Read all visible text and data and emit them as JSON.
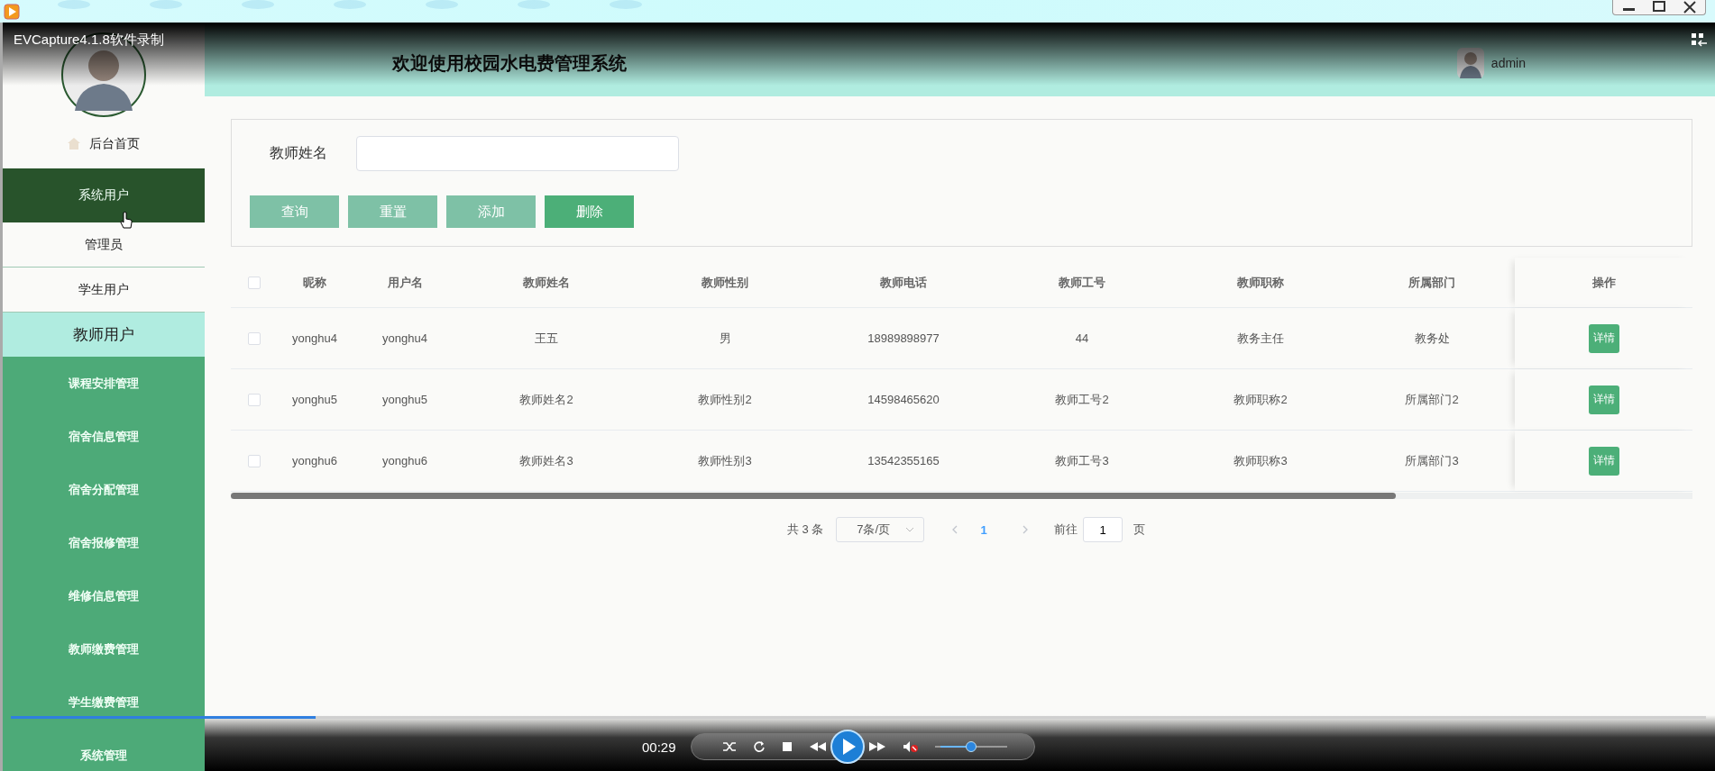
{
  "recorder": {
    "overlay_title": "EVCapture4.1.8软件录制"
  },
  "header": {
    "title": "欢迎使用校园水电费管理系统",
    "user": "admin"
  },
  "sidebar": {
    "items": [
      {
        "kind": "home",
        "label": "后台首页"
      },
      {
        "kind": "group",
        "label": "系统用户",
        "expanded": true,
        "children": [
          {
            "label": "管理员",
            "selected": false
          },
          {
            "label": "学生用户",
            "selected": false
          },
          {
            "label": "教师用户",
            "selected": true
          }
        ]
      },
      {
        "kind": "group",
        "label": "课程安排管理",
        "expanded": false
      },
      {
        "kind": "group",
        "label": "宿舍信息管理",
        "expanded": false
      },
      {
        "kind": "group",
        "label": "宿舍分配管理",
        "expanded": false
      },
      {
        "kind": "group",
        "label": "宿舍报修管理",
        "expanded": false
      },
      {
        "kind": "group",
        "label": "维修信息管理",
        "expanded": false
      },
      {
        "kind": "group",
        "label": "教师缴费管理",
        "expanded": false
      },
      {
        "kind": "group",
        "label": "学生缴费管理",
        "expanded": false
      },
      {
        "kind": "group",
        "label": "系统管理",
        "expanded": false
      }
    ]
  },
  "search": {
    "label": "教师姓名",
    "buttons": [
      {
        "label": "查询",
        "kind": "light"
      },
      {
        "label": "重置",
        "kind": "light"
      },
      {
        "label": "添加",
        "kind": "light"
      },
      {
        "label": "删除",
        "kind": "strong"
      }
    ]
  },
  "table": {
    "header_checked": false,
    "columns": [
      "昵称",
      "用户名",
      "教师姓名",
      "教师性别",
      "教师电话",
      "教师工号",
      "教师职称",
      "所属部门",
      "操作"
    ],
    "rows": [
      {
        "checked": false,
        "cells": [
          "yonghu4",
          "yonghu4",
          "王五",
          "男",
          "18989898977",
          "44",
          "教务主任",
          "教务处"
        ],
        "action": "详情"
      },
      {
        "checked": false,
        "cells": [
          "yonghu5",
          "yonghu5",
          "教师姓名2",
          "教师性别2",
          "14598465620",
          "教师工号2",
          "教师职称2",
          "所属部门2"
        ],
        "action": "详情"
      },
      {
        "checked": false,
        "cells": [
          "yonghu6",
          "yonghu6",
          "教师姓名3",
          "教师性别3",
          "13542355165",
          "教师工号3",
          "教师职称3",
          "所属部门3"
        ],
        "action": "详情"
      }
    ]
  },
  "pagination": {
    "total": "共 3 条",
    "page_size": "7条/页",
    "pages": [
      {
        "label": "1",
        "selected": true
      }
    ],
    "goto_label": "前往",
    "goto_value": "1",
    "goto_suffix": "页"
  },
  "player": {
    "time": "00:29",
    "progress": {
      "level": 0.18
    },
    "volume": {
      "level": 0.5
    },
    "muted": true
  }
}
